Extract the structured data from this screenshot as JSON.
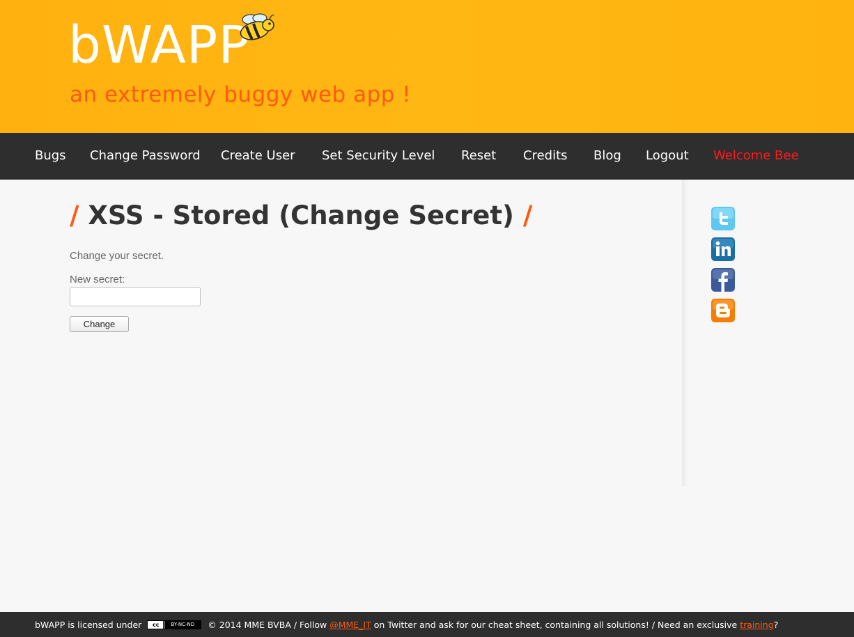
{
  "header": {
    "logo_text": "bWAPP",
    "tagline": "an extremely buggy web app !"
  },
  "nav": {
    "items": [
      {
        "label": "Bugs"
      },
      {
        "label": "Change Password"
      },
      {
        "label": "Create User"
      },
      {
        "label": "Set Security Level"
      },
      {
        "label": "Reset"
      },
      {
        "label": "Credits"
      },
      {
        "label": "Blog"
      },
      {
        "label": "Logout"
      }
    ],
    "welcome": "Welcome Bee"
  },
  "main": {
    "title_slash_left": "/",
    "title": "XSS - Stored (Change Secret)",
    "title_slash_right": "/",
    "intro": "Change your secret.",
    "secret_label": "New secret:",
    "secret_value": "",
    "change_button": "Change"
  },
  "sidebar": {
    "icons": [
      "twitter-icon",
      "linkedin-icon",
      "facebook-icon",
      "blogger-icon"
    ]
  },
  "footer": {
    "text_1": "bWAPP is licensed under",
    "cc_left": "cc",
    "cc_terms": "BY-NC-ND",
    "text_2": "© 2014 MME BVBA / Follow",
    "twitter_link": "@MME_IT",
    "text_3": "on Twitter and ask for our cheat sheet, containing all solutions! / Need an exclusive",
    "training_link": "training",
    "text_4": "?"
  },
  "colors": {
    "header_bg": "#ffb40f",
    "nav_bg": "#2e2e2e",
    "accent": "#ff5a10",
    "welcome": "#ff1a1a"
  }
}
